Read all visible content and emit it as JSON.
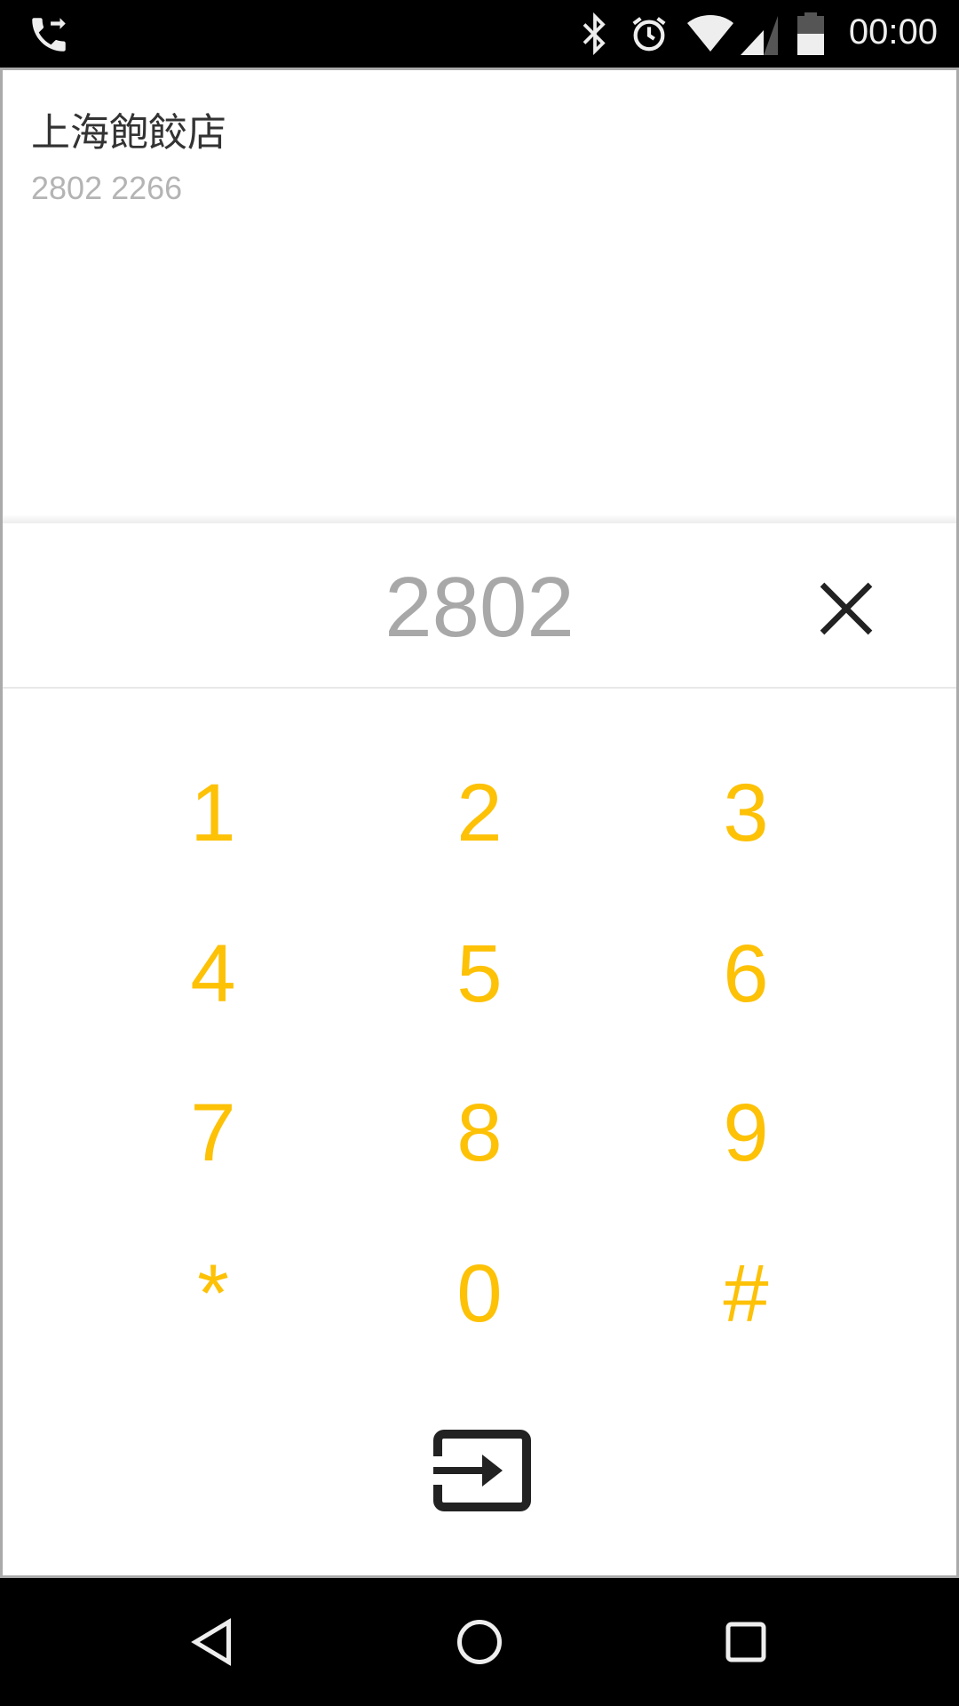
{
  "status_bar": {
    "time": "00:00",
    "icons": [
      "call-forward-icon",
      "bluetooth-icon",
      "alarm-icon",
      "wifi-icon",
      "signal-icon",
      "battery-icon"
    ]
  },
  "result": {
    "name": "上海飽餃店",
    "number": "2802 2266"
  },
  "entry": {
    "digits": "2802"
  },
  "keypad": {
    "keys": [
      "1",
      "2",
      "3",
      "4",
      "5",
      "6",
      "7",
      "8",
      "9",
      "*",
      "0",
      "#"
    ],
    "color": "#fdc106"
  },
  "nav": {
    "icons": [
      "back-icon",
      "home-icon",
      "recents-icon"
    ]
  }
}
